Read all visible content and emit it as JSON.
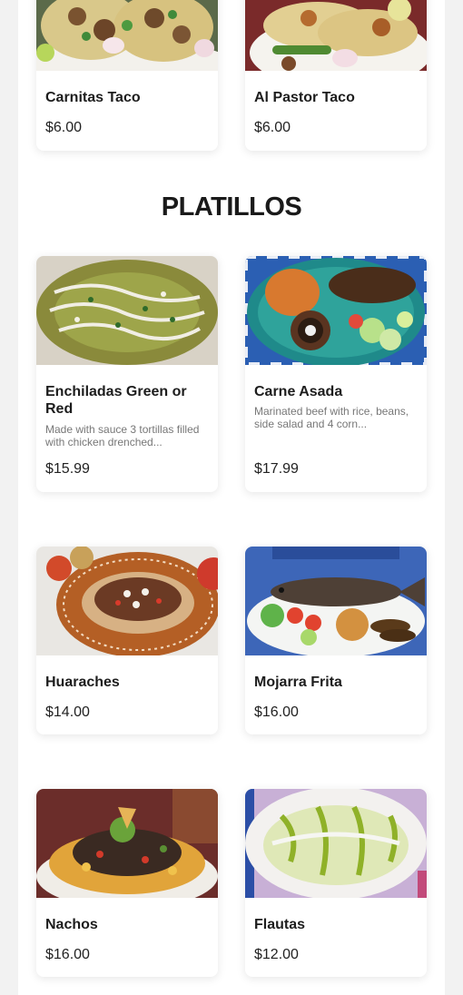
{
  "section": {
    "title": "PLATILLOS"
  },
  "items": [
    {
      "name": "Carnitas Taco",
      "price": "$6.00",
      "description": "",
      "image": "carnitas-taco-photo"
    },
    {
      "name": "Al Pastor Taco",
      "price": "$6.00",
      "description": "",
      "image": "al-pastor-taco-photo"
    },
    {
      "name": "Enchiladas Green or Red",
      "price": "$15.99",
      "description": "Made with sauce 3 tortillas filled with chicken drenched...",
      "image": "enchiladas-photo"
    },
    {
      "name": "Carne Asada",
      "price": "$17.99",
      "description": "Marinated beef with rice, beans, side salad and 4 corn...",
      "image": "carne-asada-photo"
    },
    {
      "name": "Huaraches",
      "price": "$14.00",
      "description": "",
      "image": "huaraches-photo"
    },
    {
      "name": "Mojarra Frita",
      "price": "$16.00",
      "description": "",
      "image": "mojarra-frita-photo"
    },
    {
      "name": "Nachos",
      "price": "$16.00",
      "description": "",
      "image": "nachos-photo"
    },
    {
      "name": "Flautas",
      "price": "$12.00",
      "description": "",
      "image": "flautas-photo"
    }
  ]
}
